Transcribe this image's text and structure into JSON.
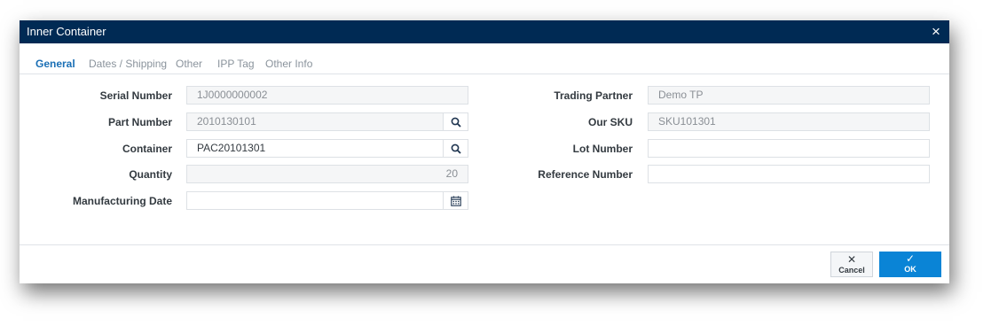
{
  "dialog": {
    "title": "Inner Container",
    "close_glyph": "×"
  },
  "tabs": [
    {
      "label": "General",
      "active": true
    },
    {
      "label": "Dates / Shipping",
      "active": false
    },
    {
      "label": "Other",
      "active": false
    },
    {
      "label": "IPP Tag",
      "active": false
    },
    {
      "label": "Other Info",
      "active": false
    }
  ],
  "left_fields": {
    "serial_number": {
      "label": "Serial Number",
      "value": "1J0000000002",
      "readonly": true
    },
    "part_number": {
      "label": "Part Number",
      "value": "2010130101",
      "readonly": true,
      "button_icon": "search-icon"
    },
    "container": {
      "label": "Container",
      "value": "PAC20101301",
      "readonly": false,
      "button_icon": "search-icon"
    },
    "quantity": {
      "label": "Quantity",
      "value": "20",
      "readonly": true
    },
    "manufacturing_date": {
      "label": "Manufacturing Date",
      "value": "",
      "readonly": false,
      "button_icon": "calendar-icon"
    }
  },
  "right_fields": {
    "trading_partner": {
      "label": "Trading Partner",
      "value": "Demo TP",
      "readonly": true
    },
    "our_sku": {
      "label": "Our SKU",
      "value": "SKU101301",
      "readonly": true
    },
    "lot_number": {
      "label": "Lot Number",
      "value": "",
      "readonly": false
    },
    "reference_number": {
      "label": "Reference Number",
      "value": "",
      "readonly": false
    }
  },
  "footer": {
    "cancel_label": "Cancel",
    "cancel_glyph": "✕",
    "ok_label": "OK",
    "ok_glyph": "✓"
  },
  "colors": {
    "titlebar": "#002a54",
    "active_tab": "#1a6fb5",
    "ok_button": "#0a84d6"
  }
}
